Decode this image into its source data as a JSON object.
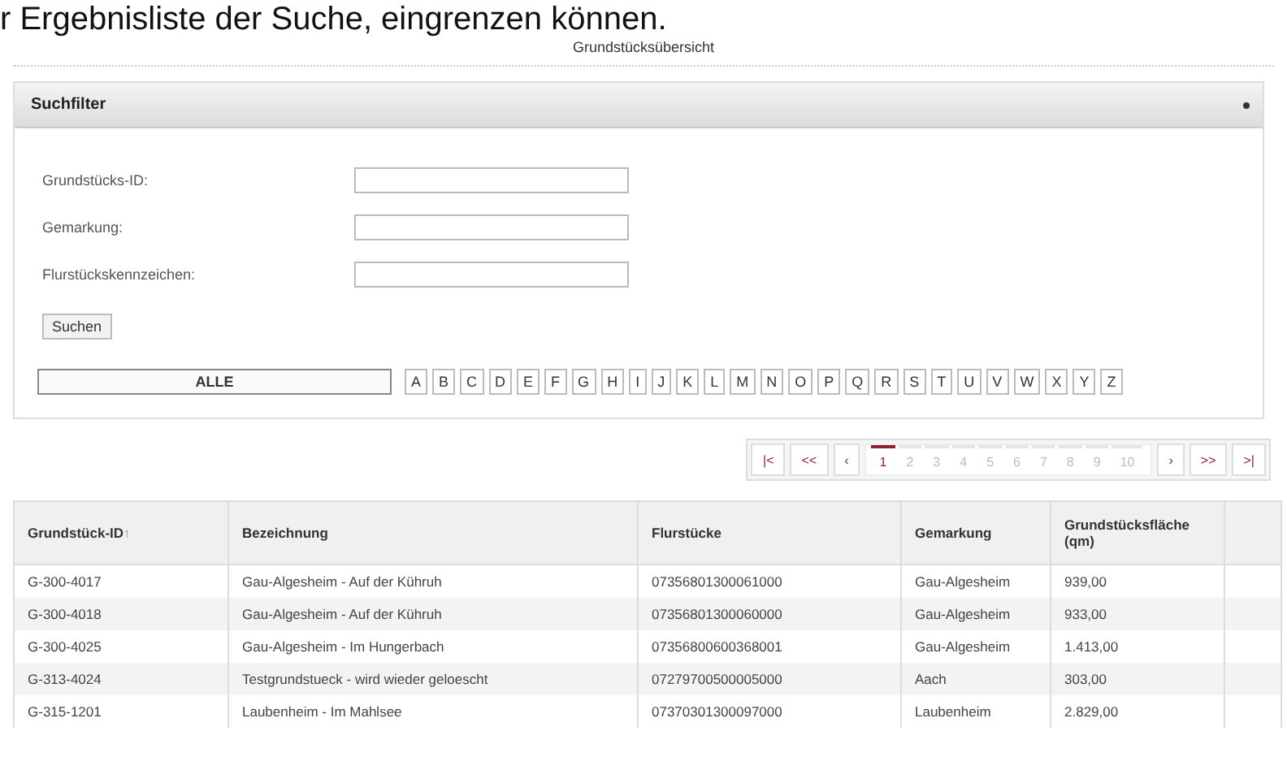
{
  "intro_text": "r Ergebnisliste der Suche, eingrenzen können.",
  "page_title": "Grundstücksübersicht",
  "search_filter": {
    "title": "Suchfilter",
    "expanded": true,
    "fields": [
      {
        "label": "Grundstücks-ID:"
      },
      {
        "label": "Gemarkung:"
      },
      {
        "label": "Flurstückskennzeichen:"
      }
    ],
    "search_button": "Suchen",
    "letter_filter": [
      {
        "label": "ALLE",
        "selected": true
      },
      {
        "label": "A",
        "selected": false
      },
      {
        "label": "B",
        "selected": false
      },
      {
        "label": "C",
        "selected": false
      },
      {
        "label": "D",
        "selected": false
      },
      {
        "label": "E",
        "selected": false
      },
      {
        "label": "F",
        "selected": false
      },
      {
        "label": "G",
        "selected": false
      },
      {
        "label": "H",
        "selected": false
      },
      {
        "label": "I",
        "selected": false
      },
      {
        "label": "J",
        "selected": false
      },
      {
        "label": "K",
        "selected": false
      },
      {
        "label": "L",
        "selected": false
      },
      {
        "label": "M",
        "selected": false
      },
      {
        "label": "N",
        "selected": false
      },
      {
        "label": "O",
        "selected": false
      },
      {
        "label": "P",
        "selected": false
      },
      {
        "label": "Q",
        "selected": false
      },
      {
        "label": "R",
        "selected": false
      },
      {
        "label": "S",
        "selected": false
      },
      {
        "label": "T",
        "selected": false
      },
      {
        "label": "U",
        "selected": false
      },
      {
        "label": "V",
        "selected": false
      },
      {
        "label": "W",
        "selected": false
      },
      {
        "label": "X",
        "selected": false
      },
      {
        "label": "Y",
        "selected": false
      },
      {
        "label": "Z",
        "selected": false
      }
    ]
  },
  "pagination": {
    "first": "|<",
    "previous_block": "<<",
    "previous": "‹",
    "pages": [
      {
        "label": "1",
        "selected": true
      },
      {
        "label": "2",
        "selected": false
      },
      {
        "label": "3",
        "selected": false
      },
      {
        "label": "4",
        "selected": false
      },
      {
        "label": "5",
        "selected": false
      },
      {
        "label": "6",
        "selected": false
      },
      {
        "label": "7",
        "selected": false
      },
      {
        "label": "8",
        "selected": false
      },
      {
        "label": "9",
        "selected": false
      },
      {
        "label": "10",
        "selected": false
      }
    ],
    "next": "›",
    "next_block": ">>",
    "last": ">|"
  },
  "table": {
    "columns": [
      {
        "label": "Grundstück-ID",
        "sort_indicator": "↑"
      },
      {
        "label": "Bezeichnung"
      },
      {
        "label": "Flurstücke"
      },
      {
        "label": "Gemarkung"
      },
      {
        "label": "Grundstücksfläche (qm)"
      }
    ],
    "rows": [
      [
        "G-300-4017",
        "Gau-Algesheim - Auf der Kühruh",
        "07356801300061000",
        "Gau-Algesheim",
        "939,00"
      ],
      [
        "G-300-4018",
        "Gau-Algesheim - Auf der Kühruh",
        "07356801300060000",
        "Gau-Algesheim",
        "933,00"
      ],
      [
        "G-300-4025",
        "Gau-Algesheim - Im Hungerbach",
        "07356800600368001",
        "Gau-Algesheim",
        "1.413,00"
      ],
      [
        "G-313-4024",
        "Testgrundstueck - wird wieder geloescht",
        "07279700500005000",
        "Aach",
        "303,00"
      ],
      [
        "G-315-1201",
        "Laubenheim - Im Mahlsee",
        "07370301300097000",
        "Laubenheim",
        "2.829,00"
      ]
    ]
  }
}
